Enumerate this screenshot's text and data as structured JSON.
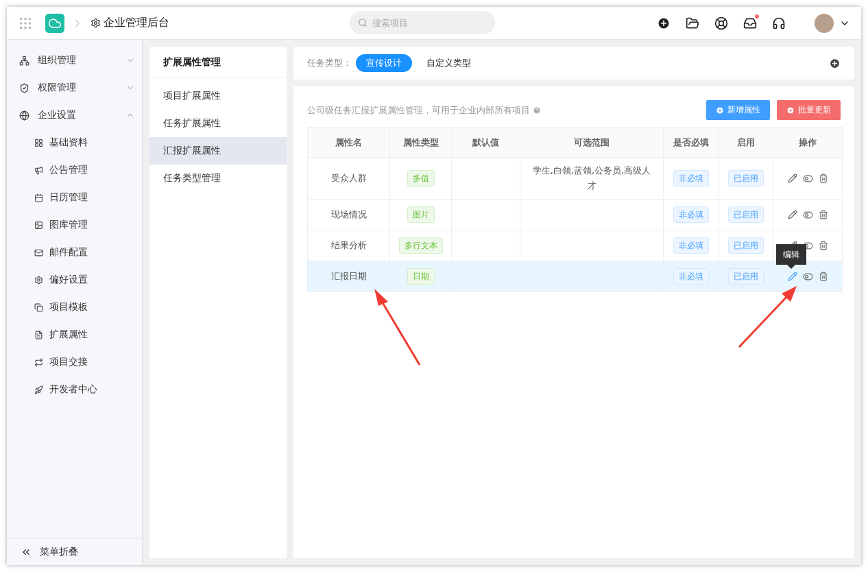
{
  "header": {
    "title": "企业管理后台",
    "search": {
      "placeholder": "搜索项目"
    }
  },
  "sidebar": {
    "items": [
      {
        "label": "组织管理",
        "expanded": false
      },
      {
        "label": "权限管理",
        "expanded": false
      },
      {
        "label": "企业设置",
        "expanded": true,
        "children": [
          {
            "label": "基础资料"
          },
          {
            "label": "公告管理"
          },
          {
            "label": "日历管理"
          },
          {
            "label": "图库管理"
          },
          {
            "label": "邮件配置"
          },
          {
            "label": "偏好设置"
          },
          {
            "label": "项目模板"
          },
          {
            "label": "扩展属性"
          },
          {
            "label": "项目交接"
          },
          {
            "label": "开发者中心"
          }
        ]
      }
    ],
    "collapse_label": "菜单折叠"
  },
  "subnav": {
    "title": "扩展属性管理",
    "items": [
      {
        "label": "项目扩展属性",
        "selected": false
      },
      {
        "label": "任务扩展属性",
        "selected": false
      },
      {
        "label": "汇报扩展属性",
        "selected": true
      },
      {
        "label": "任务类型管理",
        "selected": false
      }
    ]
  },
  "task_types": {
    "label": "任务类型：",
    "items": [
      {
        "label": "宣传设计",
        "selected": true
      },
      {
        "label": "自定义类型",
        "selected": false
      }
    ]
  },
  "panel": {
    "description": "公司级任务汇报扩展属性管理，可用于企业内部所有项目",
    "buttons": [
      {
        "label": "新增属性",
        "kind": "primary"
      },
      {
        "label": "批量更新",
        "kind": "danger"
      }
    ]
  },
  "table": {
    "columns": [
      "属性名",
      "属性类型",
      "默认值",
      "可选范围",
      "是否必填",
      "启用",
      "操作"
    ],
    "rows": [
      {
        "name": "受众人群",
        "type": "多值",
        "default": "",
        "range": "学生,白领,蓝领,公务员,高级人才",
        "required": "非必填",
        "enabled": "已启用",
        "selected": false
      },
      {
        "name": "现场情况",
        "type": "图片",
        "default": "",
        "range": "",
        "required": "非必填",
        "enabled": "已启用",
        "selected": false
      },
      {
        "name": "结果分析",
        "type": "多行文本",
        "default": "",
        "range": "",
        "required": "非必填",
        "enabled": "已启用",
        "selected": false
      },
      {
        "name": "汇报日期",
        "type": "日期",
        "default": "",
        "range": "",
        "required": "非必填",
        "enabled": "已启用",
        "selected": true,
        "tooltip": "编辑"
      }
    ]
  }
}
